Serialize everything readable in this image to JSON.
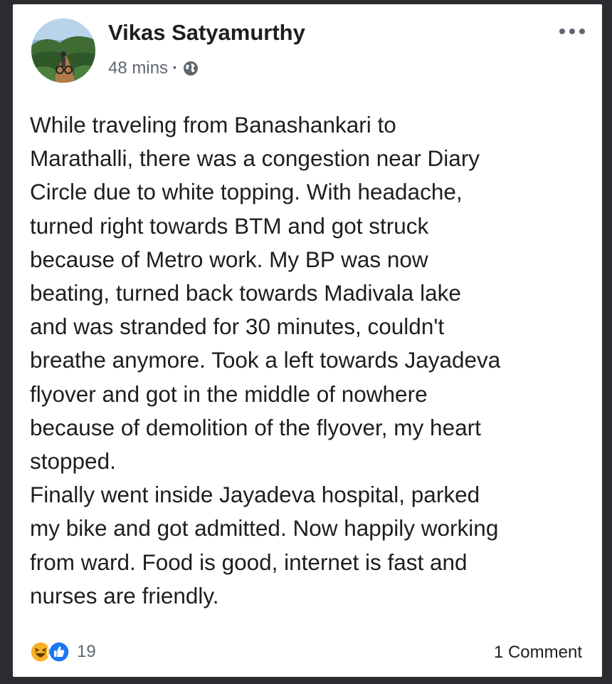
{
  "post": {
    "author": "Vikas Satyamurthy",
    "time": "48 mins",
    "privacy_icon": "globe-icon",
    "more_icon": "more-options-icon",
    "lines": [
      "While traveling from Banashankari to",
      "Marathalli, there was a congestion near Diary",
      "Circle due to white topping. With headache,",
      "turned right towards BTM and got struck",
      "because of Metro work. My BP was now",
      "beating, turned back towards Madivala lake",
      "and was stranded for 30 minutes, couldn't",
      "breathe anymore. Took a left towards Jayadeva",
      "flyover and got in the middle of nowhere",
      "because of demolition of the flyover, my heart",
      "stopped.",
      "Finally went inside Jayadeva hospital, parked",
      "my bike and got admitted. Now happily working",
      "from ward. Food is good, internet is fast and",
      "nurses are friendly."
    ]
  },
  "footer": {
    "reaction_icons": [
      "haha-icon",
      "like-icon"
    ],
    "reaction_count": "19",
    "comments": "1 Comment"
  },
  "colors": {
    "text": "#1c1e21",
    "secondary_text": "#606770",
    "like_blue": "#1877f2",
    "haha_yellow": "#f7b125"
  }
}
